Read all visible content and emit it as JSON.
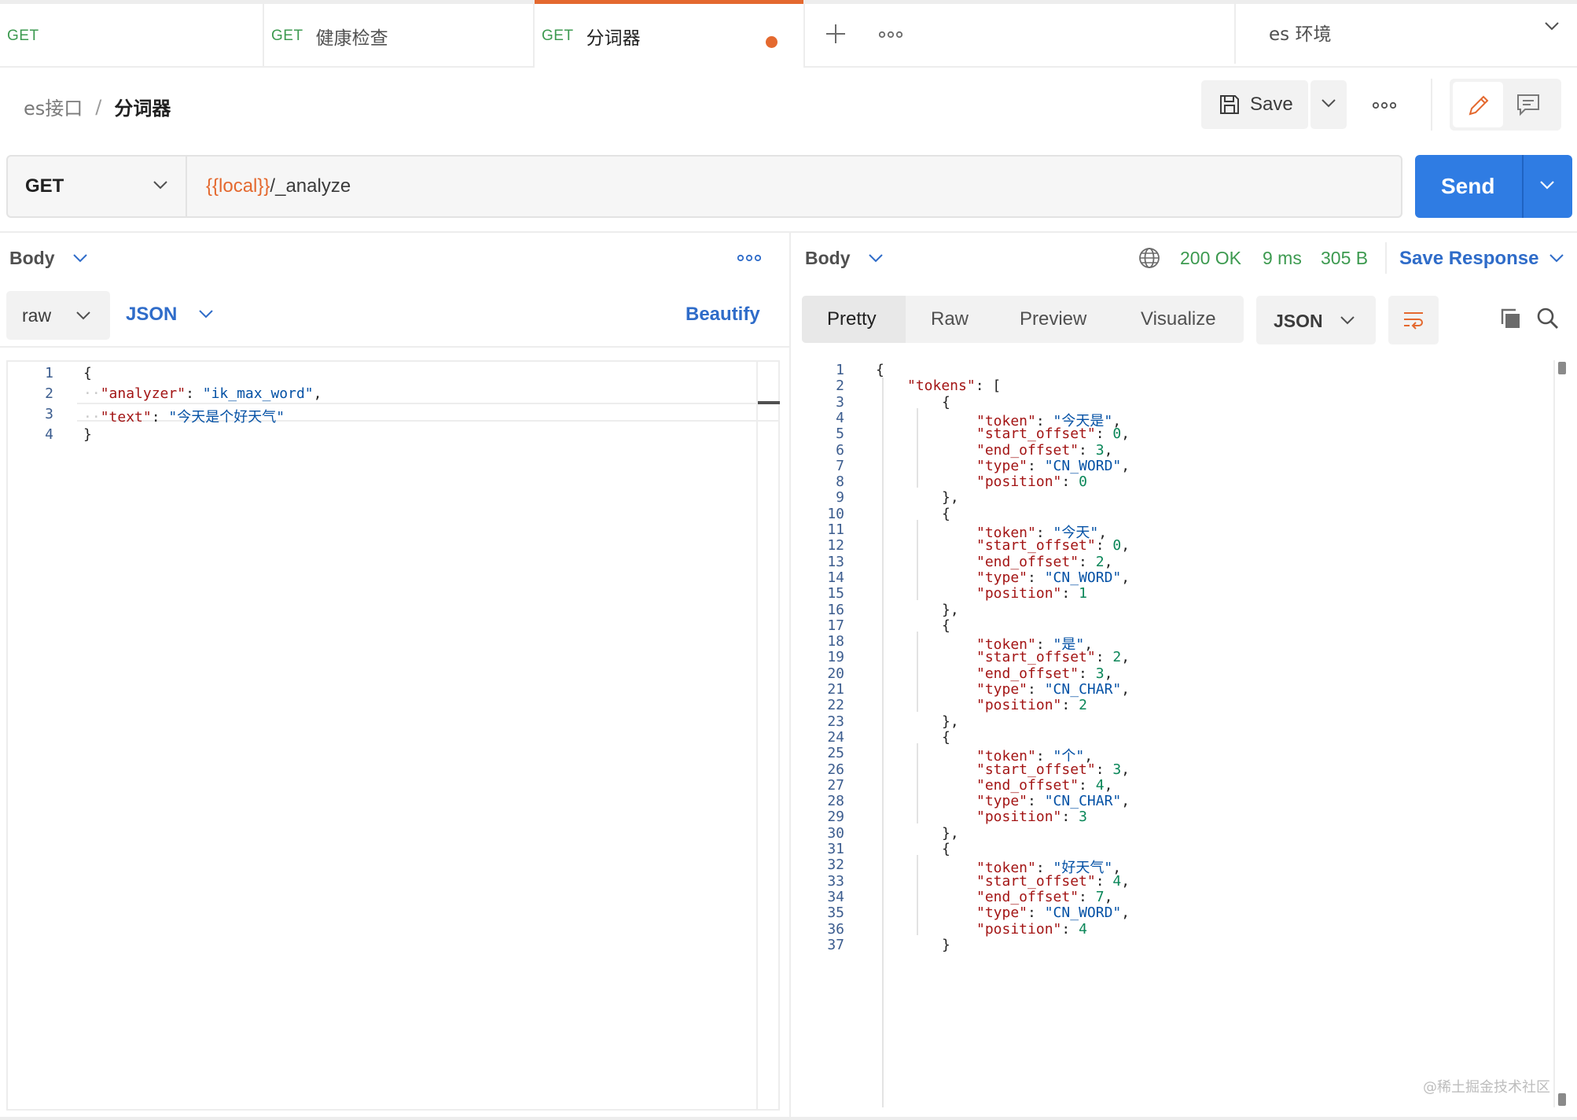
{
  "tabs": [
    {
      "method": "GET",
      "title": "",
      "unsaved": false
    },
    {
      "method": "GET",
      "title": "健康检查",
      "unsaved": true
    },
    {
      "method": "GET",
      "title": "分词器",
      "unsaved": true,
      "active": true
    }
  ],
  "environment": "es 环境",
  "breadcrumb": {
    "parent": "es接口",
    "separator": "/",
    "current": "分词器"
  },
  "toolbar": {
    "save_label": "Save"
  },
  "request": {
    "method": "GET",
    "url_variable": "{{local}}",
    "url_path": "/_analyze",
    "send_label": "Send",
    "body_label": "Body",
    "body_mode": "raw",
    "body_language": "JSON",
    "beautify_label": "Beautify",
    "lines": [
      {
        "num": "1",
        "text": "{"
      },
      {
        "num": "2",
        "key": "\"analyzer\"",
        "value": "\"ik_max_word\"",
        "trail": ","
      },
      {
        "num": "3",
        "key": "\"text\"",
        "value": "\"今天是个好天气\"",
        "trail": ""
      },
      {
        "num": "4",
        "text": "}"
      }
    ]
  },
  "response": {
    "body_label": "Body",
    "status": "200 OK",
    "time": "9 ms",
    "size": "305 B",
    "save_response_label": "Save Response",
    "view_tabs": [
      "Pretty",
      "Raw",
      "Preview",
      "Visualize"
    ],
    "active_view": "Pretty",
    "format": "JSON",
    "line_numbers": [
      "1",
      "2",
      "3",
      "4",
      "5",
      "6",
      "7",
      "8",
      "9",
      "10",
      "11",
      "12",
      "13",
      "14",
      "15",
      "16",
      "17",
      "18",
      "19",
      "20",
      "21",
      "22",
      "23",
      "24",
      "25",
      "26",
      "27",
      "28",
      "29",
      "30",
      "31",
      "32",
      "33",
      "34",
      "35",
      "36",
      "37"
    ],
    "tokens": [
      {
        "token": "\"今天是\"",
        "start_offset": "0",
        "end_offset": "3",
        "type": "\"CN_WORD\"",
        "position": "0"
      },
      {
        "token": "\"今天\"",
        "start_offset": "0",
        "end_offset": "2",
        "type": "\"CN_WORD\"",
        "position": "1"
      },
      {
        "token": "\"是\"",
        "start_offset": "2",
        "end_offset": "3",
        "type": "\"CN_CHAR\"",
        "position": "2"
      },
      {
        "token": "\"个\"",
        "start_offset": "3",
        "end_offset": "4",
        "type": "\"CN_CHAR\"",
        "position": "3"
      },
      {
        "token": "\"好天气\"",
        "start_offset": "4",
        "end_offset": "7",
        "type": "\"CN_WORD\"",
        "position": "4"
      }
    ]
  },
  "watermark": "@稀土掘金技术社区",
  "colors": {
    "accent": "#e4692f",
    "primary": "#2f7ce3",
    "success": "#3d9a50"
  }
}
